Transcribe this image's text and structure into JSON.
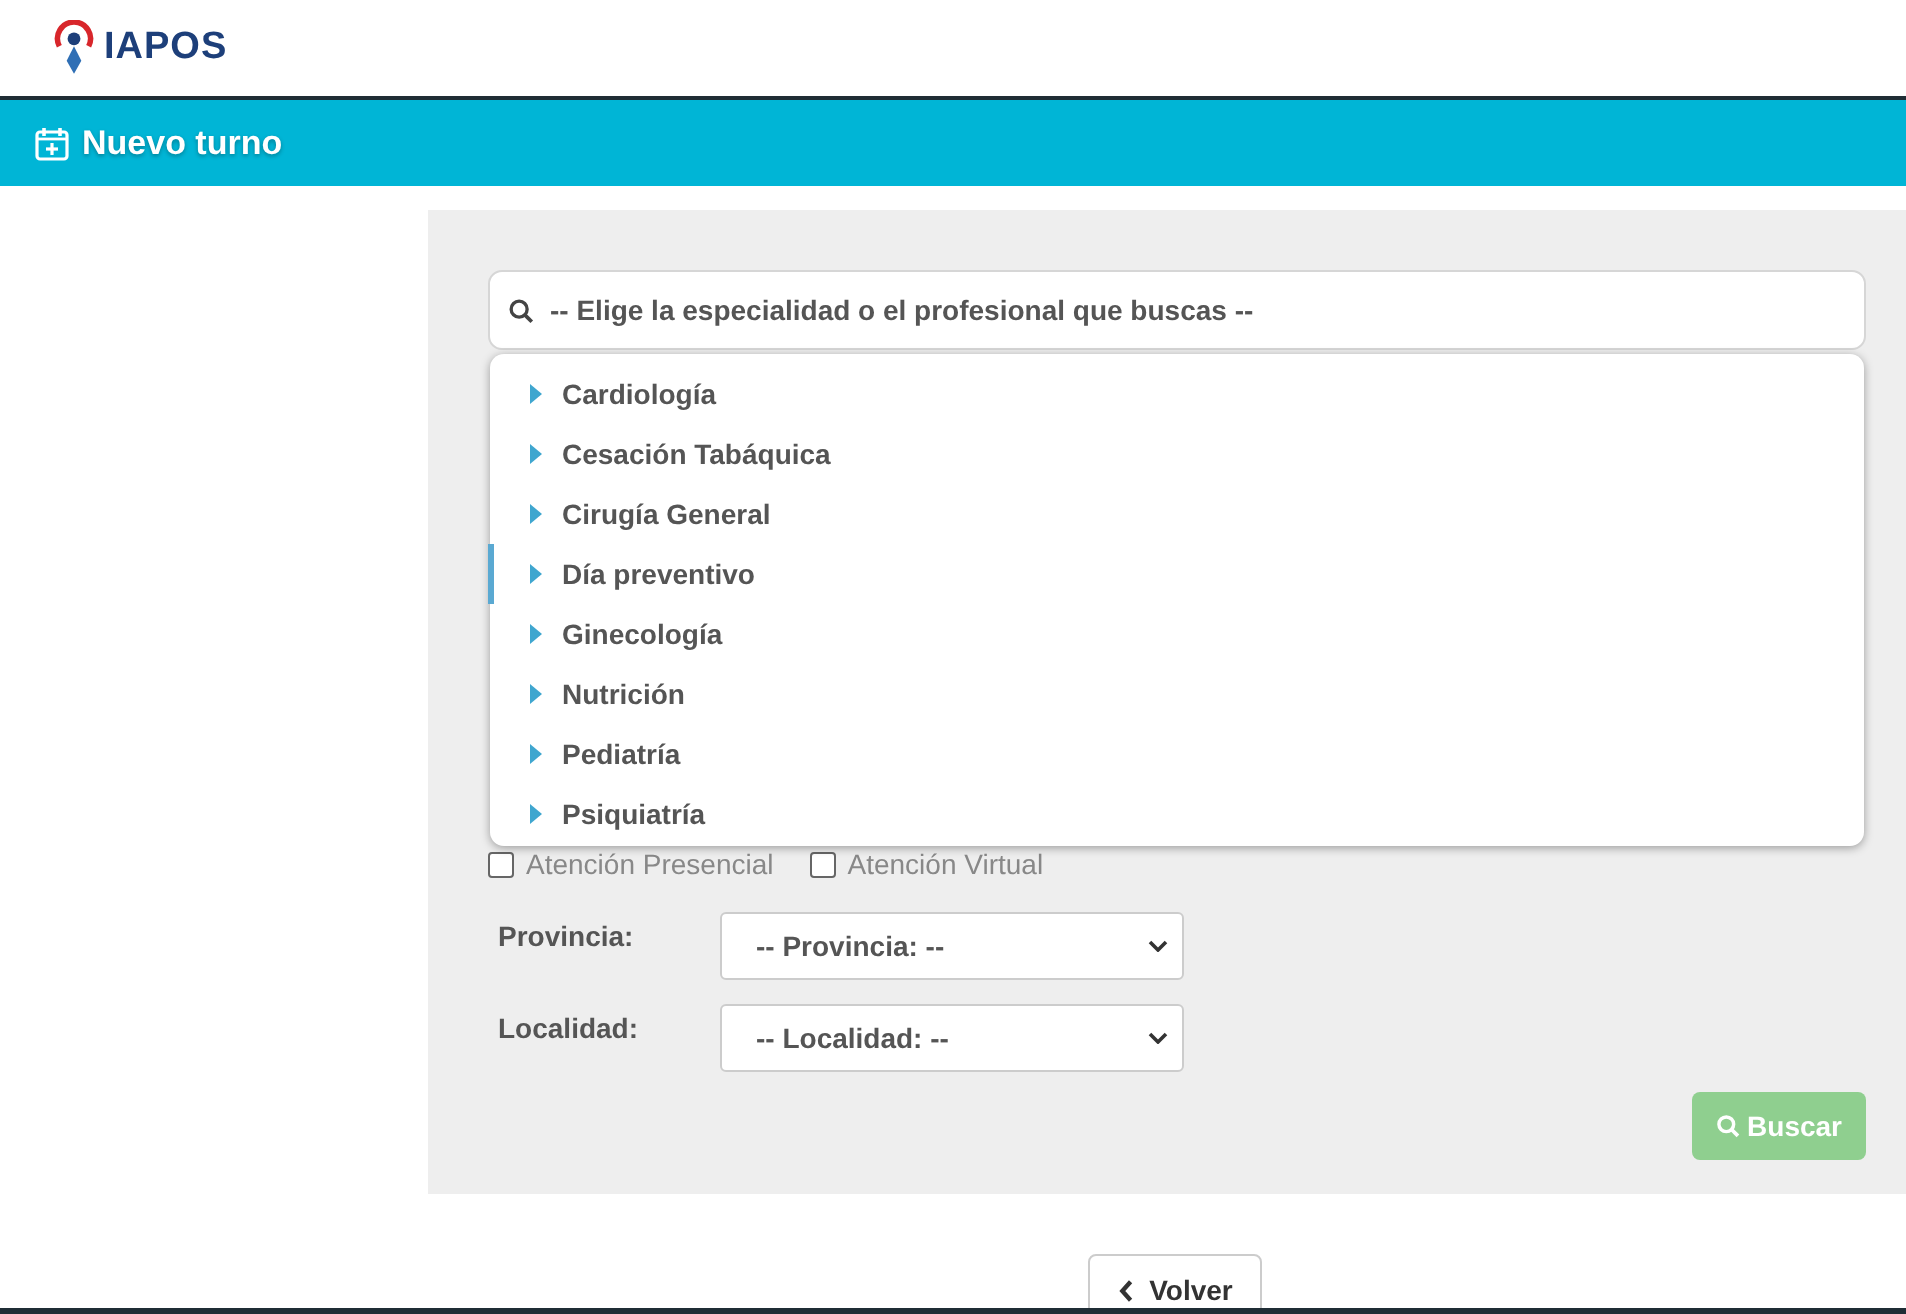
{
  "header": {
    "logo_text": "IAPOS"
  },
  "title_bar": {
    "title": "Nuevo turno"
  },
  "search": {
    "placeholder": "-- Elige la especialidad o el profesional que buscas --"
  },
  "dropdown": {
    "items": [
      {
        "label": "Cardiología",
        "selected": false
      },
      {
        "label": "Cesación Tabáquica",
        "selected": false
      },
      {
        "label": "Cirugía General",
        "selected": false
      },
      {
        "label": "Día preventivo",
        "selected": true
      },
      {
        "label": "Ginecología",
        "selected": false
      },
      {
        "label": "Nutrición",
        "selected": false
      },
      {
        "label": "Pediatría",
        "selected": false
      },
      {
        "label": "Psiquiatría",
        "selected": false
      }
    ]
  },
  "checkboxes": [
    {
      "label": "Atención Presencial",
      "checked": false
    },
    {
      "label": "Atención Virtual",
      "checked": false
    }
  ],
  "selects": [
    {
      "label": "Provincia:",
      "value": "-- Provincia: --"
    },
    {
      "label": "Localidad:",
      "value": "-- Localidad: --"
    }
  ],
  "search_button": {
    "label": "Buscar",
    "disabled": true
  },
  "back_button": {
    "label": "Volver"
  }
}
